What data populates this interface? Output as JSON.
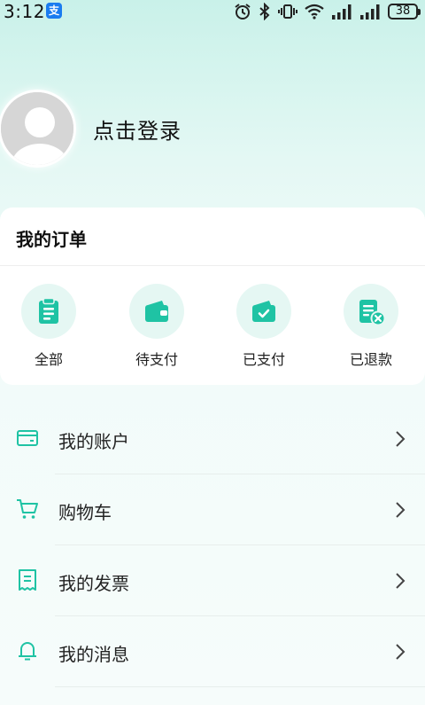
{
  "status_bar": {
    "time": "3:12",
    "alipay_badge": "支",
    "battery": "38"
  },
  "profile": {
    "login_text": "点击登录"
  },
  "orders": {
    "title": "我的订单",
    "items": [
      {
        "label": "全部",
        "icon": "clipboard-icon"
      },
      {
        "label": "待支付",
        "icon": "wallet-icon"
      },
      {
        "label": "已支付",
        "icon": "paid-wallet-icon"
      },
      {
        "label": "已退款",
        "icon": "refund-doc-icon"
      }
    ]
  },
  "menu": {
    "items": [
      {
        "label": "我的账户",
        "icon": "card-icon"
      },
      {
        "label": "购物车",
        "icon": "cart-icon"
      },
      {
        "label": "我的发票",
        "icon": "invoice-icon"
      },
      {
        "label": "我的消息",
        "icon": "bell-icon"
      }
    ]
  },
  "colors": {
    "accent": "#1fc3a4",
    "icon_bg": "#e5f7f3"
  }
}
